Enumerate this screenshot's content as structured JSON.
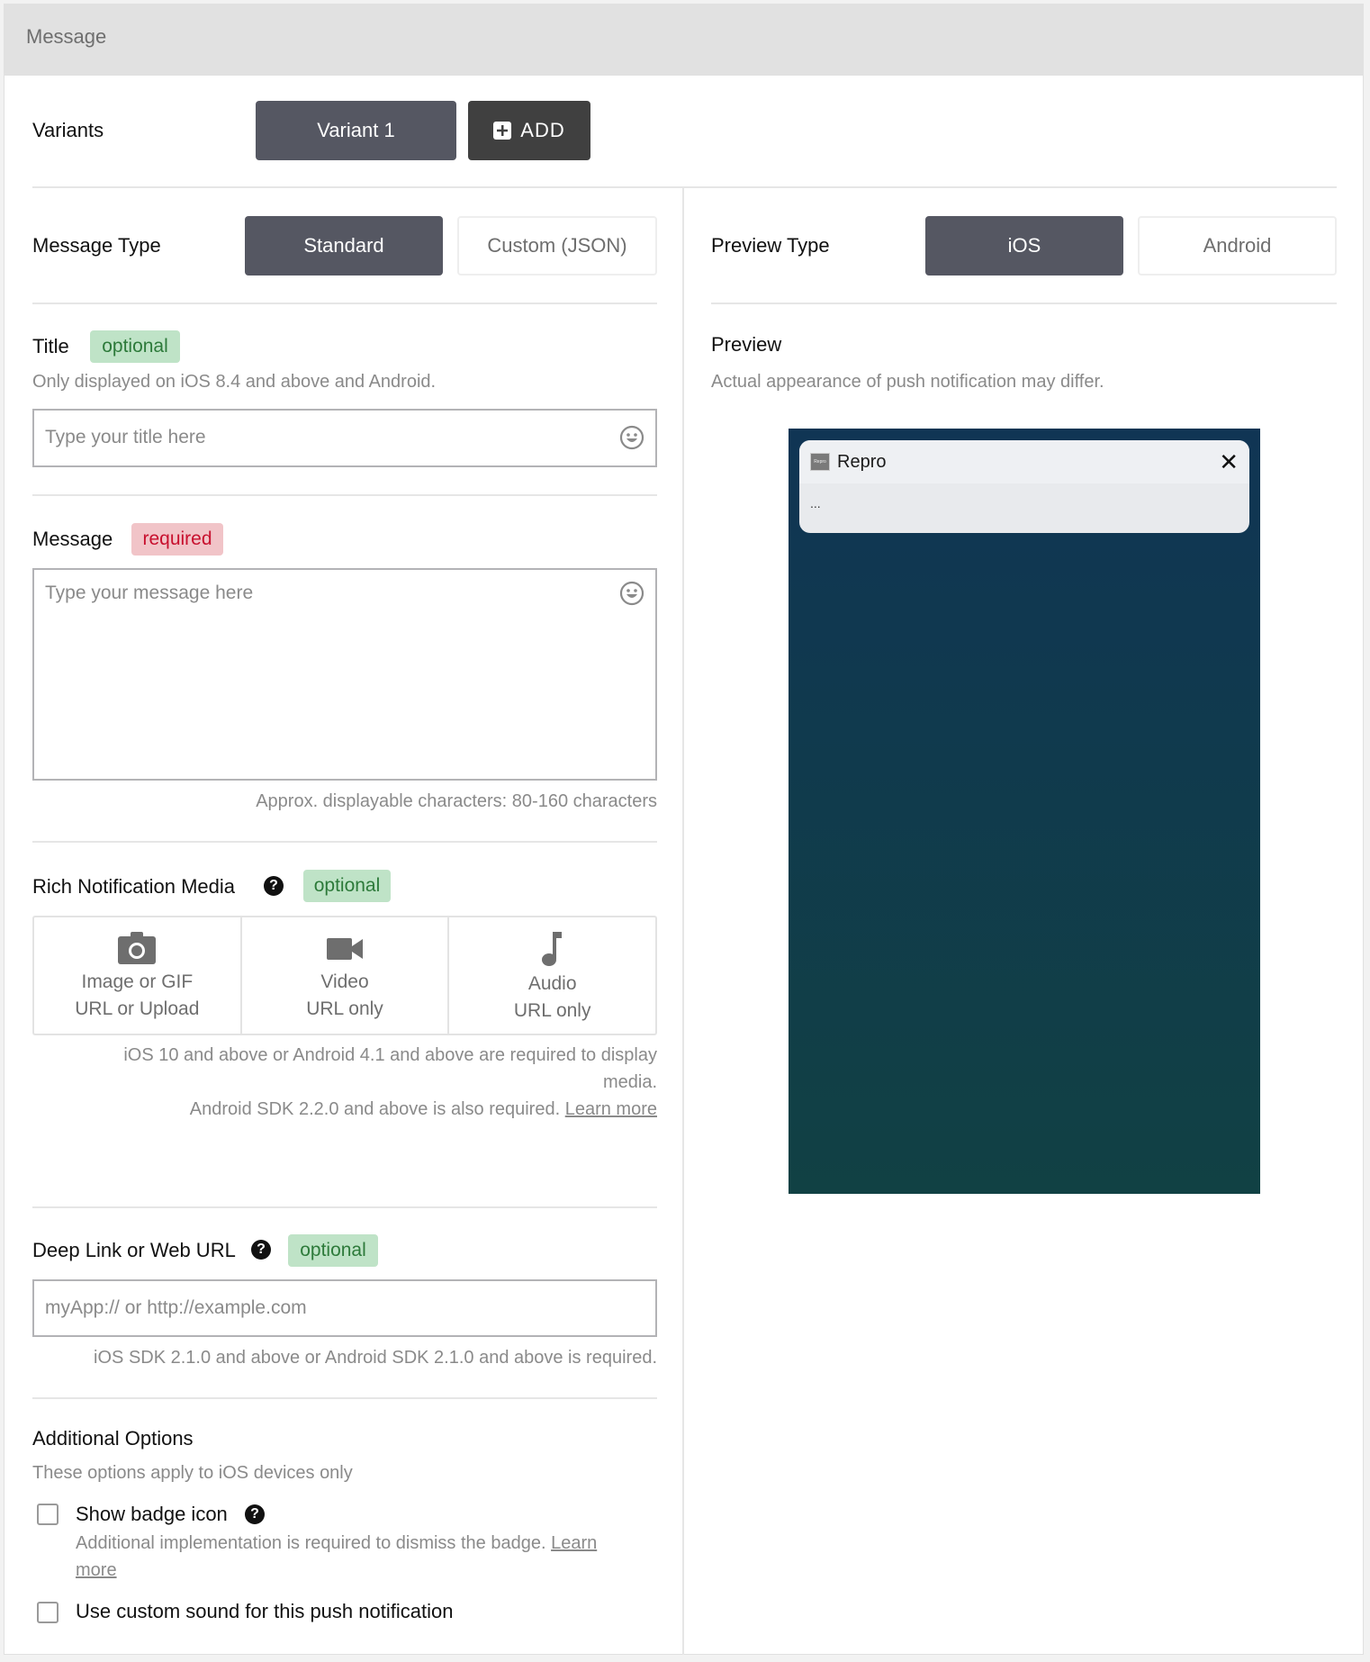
{
  "panel": {
    "title": "Message"
  },
  "variants": {
    "label": "Variants",
    "items": [
      {
        "label": "Variant 1",
        "selected": true
      }
    ],
    "add_label": "ADD",
    "add_icon": "plus-square-icon"
  },
  "message_type": {
    "label": "Message Type",
    "options": [
      {
        "label": "Standard",
        "selected": true
      },
      {
        "label": "Custom (JSON)",
        "selected": false
      }
    ]
  },
  "preview_type": {
    "label": "Preview Type",
    "options": [
      {
        "label": "iOS",
        "selected": true
      },
      {
        "label": "Android",
        "selected": false
      }
    ]
  },
  "title_field": {
    "label": "Title",
    "badge": "optional",
    "helper": "Only displayed on iOS 8.4 and above and Android.",
    "placeholder": "Type your title here",
    "value": ""
  },
  "message_field": {
    "label": "Message",
    "badge": "required",
    "placeholder": "Type your message here",
    "value": "",
    "hint": "Approx. displayable characters: 80-160 characters"
  },
  "rich_media": {
    "label": "Rich Notification Media",
    "badge": "optional",
    "options": [
      {
        "icon": "camera-icon",
        "title": "Image or GIF",
        "subtitle": "URL or Upload"
      },
      {
        "icon": "video-camera-icon",
        "title": "Video",
        "subtitle": "URL only"
      },
      {
        "icon": "music-note-icon",
        "title": "Audio",
        "subtitle": "URL only"
      }
    ],
    "note_line1": "iOS 10 and above or Android 4.1 and above are required to display",
    "note_line2": "media.",
    "note_line3": "Android SDK 2.2.0 and above is also required.",
    "learn_more": "Learn more"
  },
  "deep_link": {
    "label": "Deep Link or Web URL",
    "badge": "optional",
    "placeholder": "myApp:// or http://example.com",
    "value": "",
    "note": "iOS SDK 2.1.0 and above or Android SDK 2.1.0 and above is required."
  },
  "additional_options": {
    "label": "Additional Options",
    "subtitle": "These options apply to iOS devices only",
    "badge_option": {
      "label": "Show badge icon",
      "checked": false,
      "desc": "Additional implementation is required to dismiss the badge.",
      "learn": "Learn",
      "more": "more"
    },
    "sound_option": {
      "label": "Use custom sound for this push notification",
      "checked": false
    }
  },
  "preview": {
    "label": "Preview",
    "subtitle": "Actual appearance of push notification may differ.",
    "notification": {
      "app_name": "Repro",
      "app_icon_text": "Repro",
      "body": "..."
    }
  },
  "colors": {
    "selected_button": "#555762",
    "add_button": "#404040",
    "optional_badge_bg": "#bfe3c7",
    "optional_badge_text": "#2d7a3a",
    "required_badge_bg": "#f1c4c8",
    "required_badge_text": "#c8102e",
    "preview_gradient_top": "#103554",
    "preview_gradient_bottom": "#114144"
  }
}
